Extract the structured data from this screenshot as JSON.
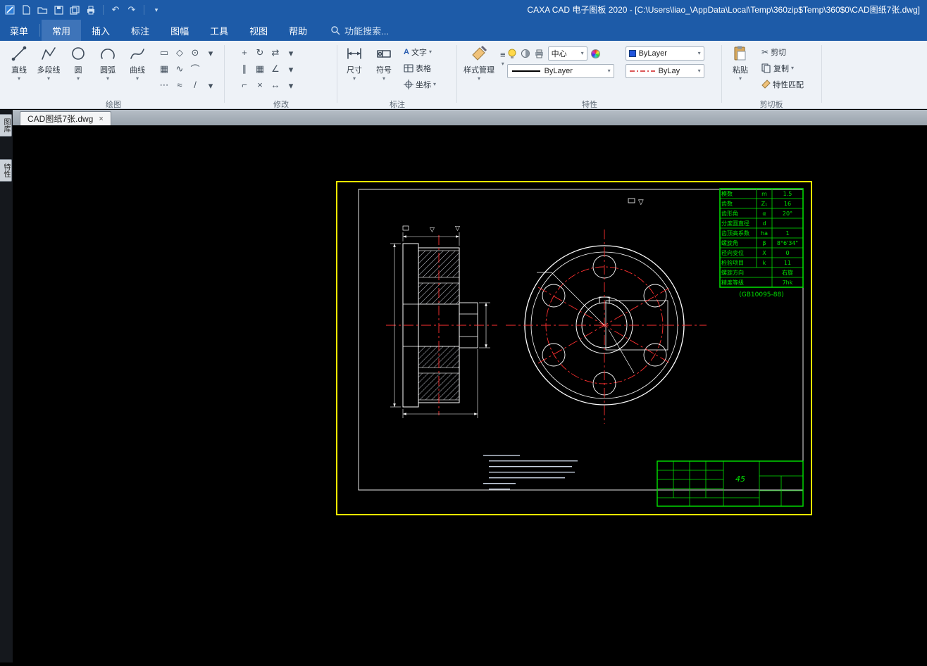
{
  "title_bar": {
    "title": "CAXA CAD 电子图板 2020 - [C:\\Users\\liao_\\AppData\\Local\\Temp\\360zip$Temp\\360$0\\CAD图纸7张.dwg]"
  },
  "menu_bar": {
    "menu_button": "菜单",
    "tabs": [
      "常用",
      "插入",
      "标注",
      "图幅",
      "工具",
      "视图",
      "帮助"
    ],
    "active_tab": "常用",
    "search_placeholder": "功能搜索..."
  },
  "ribbon": {
    "groups": {
      "draw": {
        "label": "绘图",
        "buttons": [
          "直线",
          "多段线",
          "圆",
          "圆弧",
          "曲线"
        ]
      },
      "modify": {
        "label": "修改"
      },
      "annotate": {
        "label": "标注",
        "dimension": "尺寸",
        "symbol": "符号",
        "text": "文字",
        "table": "表格",
        "coord": "坐标"
      },
      "properties": {
        "label": "特性",
        "style_manager": "样式管理",
        "center": "中心",
        "bylayer_color": "ByLayer",
        "bylayer_line": "ByLayer",
        "bylayer_style": "ByLay"
      },
      "clipboard": {
        "label": "剪切板",
        "paste": "粘贴",
        "cut": "剪切",
        "copy": "复制",
        "match": "特性匹配"
      }
    }
  },
  "document_tabs": [
    {
      "label": "CAD图纸7张.dwg",
      "close": "×"
    }
  ],
  "side_panel": {
    "tabs": [
      "图库",
      "特性"
    ]
  },
  "drawing": {
    "roughness": "▽",
    "param_table": {
      "rows": [
        {
          "name": "模数",
          "sym": "m",
          "val": "1.5"
        },
        {
          "name": "齿数",
          "sym": "Z₁",
          "val": "16"
        },
        {
          "name": "齿形角",
          "sym": "α",
          "val": "20°"
        },
        {
          "name": "分度圆直径",
          "sym": "d",
          "val": ""
        },
        {
          "name": "齿顶高系数",
          "sym": "ha",
          "val": "1"
        },
        {
          "name": "螺旋角",
          "sym": "β",
          "val": "8°6'34\""
        },
        {
          "name": "径向变位",
          "sym": "X",
          "val": "0"
        },
        {
          "name": "检验项目",
          "sym": "k",
          "val": "11"
        },
        {
          "name": "螺旋方向",
          "sym": "",
          "val": "右旋"
        },
        {
          "name": "精度等级",
          "sym": "",
          "val": "7hk"
        }
      ],
      "standard": "(GB10095-88)"
    },
    "title_block": {
      "material": "45"
    }
  },
  "colors": {
    "accent_blue": "#1d5ba8",
    "cad_yellow": "#ffe900",
    "cad_green": "#00e400",
    "cad_red": "#ff3030"
  }
}
